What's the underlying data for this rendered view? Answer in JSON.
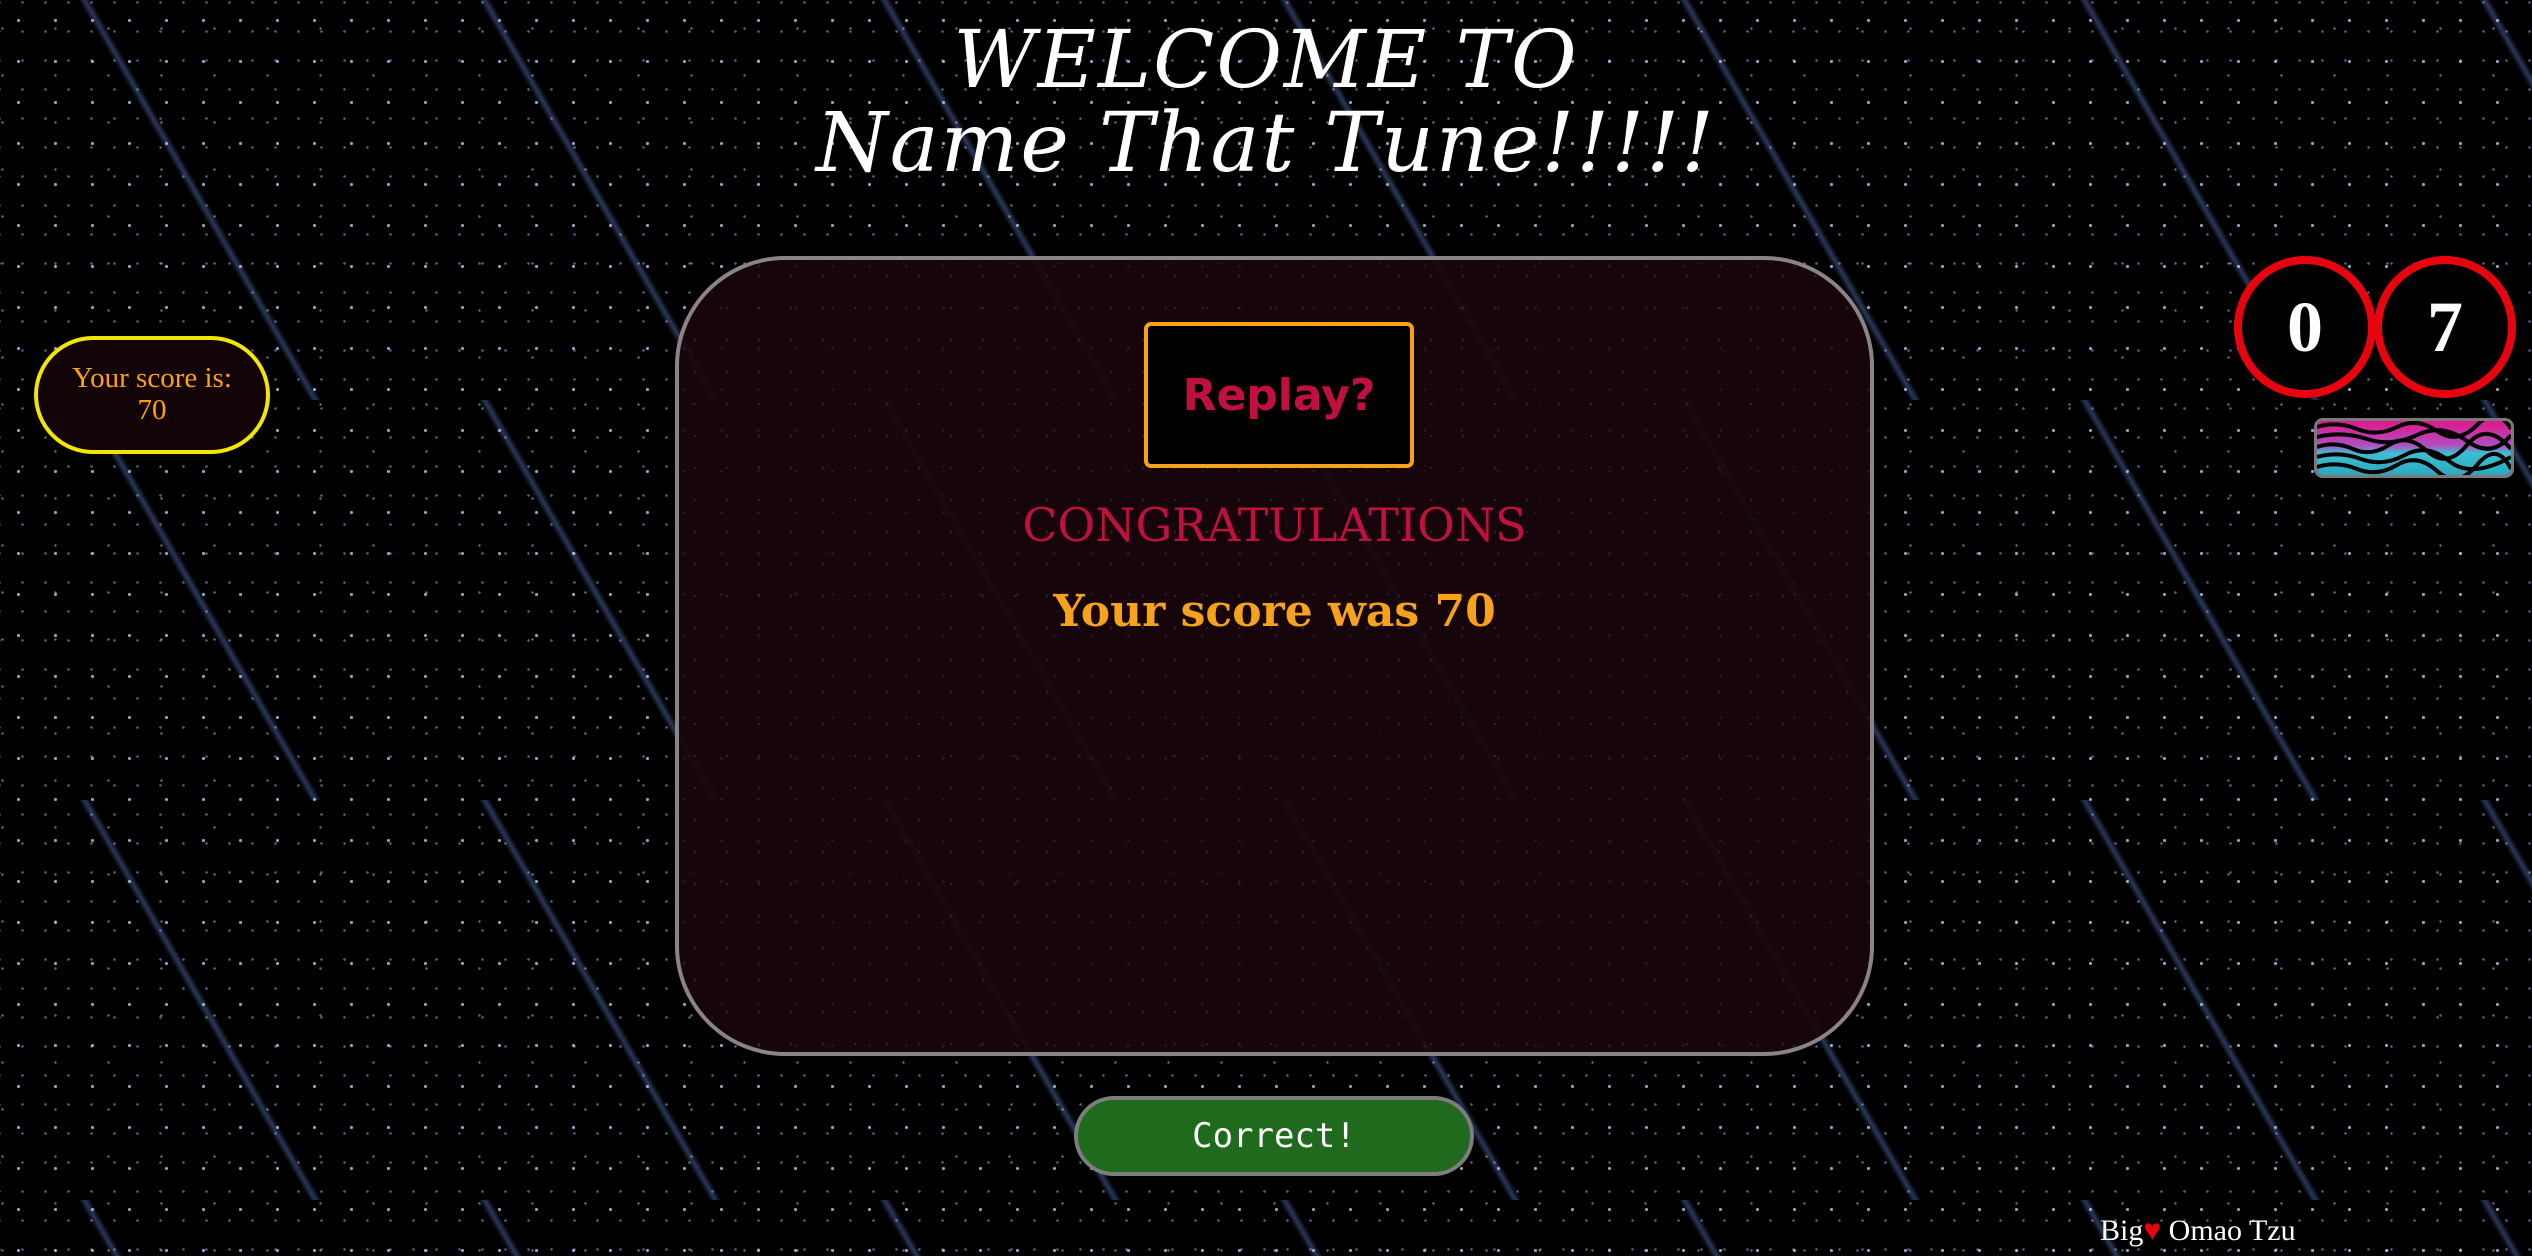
{
  "header": {
    "title_line1": "WELCOME TO",
    "title_line2": "Name That Tune!!!!!"
  },
  "score_badge": {
    "text": "Your score is: 70"
  },
  "panel": {
    "replay_label": "Replay?",
    "congrats_text": "CONGRATULATIONS",
    "score_text": "Your score was 70"
  },
  "actions": {
    "correct_label": "Correct!"
  },
  "counters": {
    "digit1": "0",
    "digit2": "7"
  },
  "footer": {
    "prefix": "Big",
    "heart_icon": "heart-icon",
    "heart_glyph": "♥",
    "name": "Omao Tzu"
  },
  "colors": {
    "accent_pink": "#c0103f",
    "accent_orange": "#f7a21b",
    "correct_green": "#1f6a1c",
    "counter_red": "#e8040e",
    "badge_yellow": "#f2e600"
  }
}
